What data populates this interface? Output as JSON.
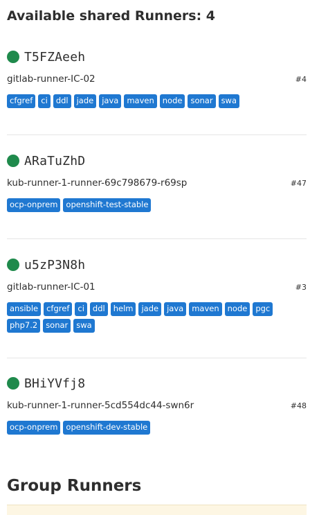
{
  "page": {
    "title": "Available shared Runners: 4",
    "group_title": "Group Runners"
  },
  "colors": {
    "status_online": "#1f8a4c",
    "tag_bg": "#1f78d1",
    "notice_bg": "#fdf6e3"
  },
  "runners": [
    {
      "token": "T5FZAeeh",
      "description": "gitlab-runner-IC-02",
      "id": "#4",
      "tags": [
        "cfgref",
        "ci",
        "ddl",
        "jade",
        "java",
        "maven",
        "node",
        "sonar",
        "swa"
      ]
    },
    {
      "token": "ARaTuZhD",
      "description": "kub-runner-1-runner-69c798679-r69sp",
      "id": "#47",
      "tags": [
        "ocp-onprem",
        "openshift-test-stable"
      ]
    },
    {
      "token": "u5zP3N8h",
      "description": "gitlab-runner-IC-01",
      "id": "#3",
      "tags": [
        "ansible",
        "cfgref",
        "ci",
        "ddl",
        "helm",
        "jade",
        "java",
        "maven",
        "node",
        "pgc",
        "php7.2",
        "sonar",
        "swa"
      ]
    },
    {
      "token": "BHiYVfj8",
      "description": "kub-runner-1-runner-5cd554dc44-swn6r",
      "id": "#48",
      "tags": [
        "ocp-onprem",
        "openshift-dev-stable"
      ]
    }
  ]
}
